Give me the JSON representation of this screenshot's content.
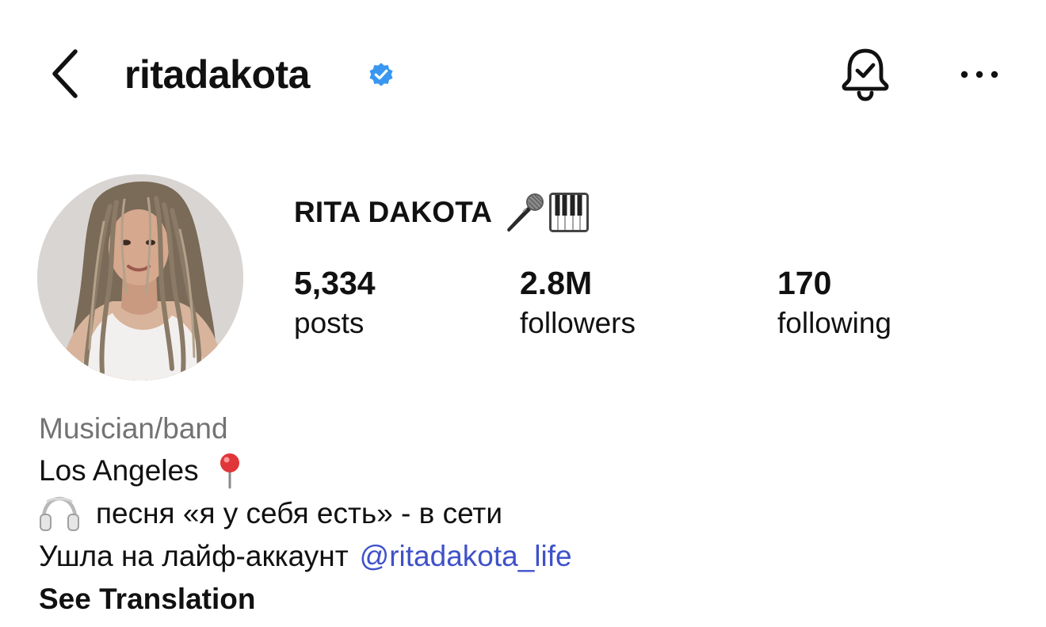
{
  "header": {
    "username": "ritadakota",
    "verified": true,
    "icons": {
      "back": "chevron-left-icon",
      "verified": "verified-badge-icon",
      "notifications": "bell-check-icon",
      "more": "ellipsis-icon"
    }
  },
  "profile": {
    "display_name": "RITA DAKOTA",
    "name_emojis": [
      "microphone-icon",
      "piano-keys-icon"
    ],
    "stats": {
      "posts": {
        "value": "5,334",
        "label": "posts"
      },
      "followers": {
        "value": "2.8M",
        "label": "followers"
      },
      "following": {
        "value": "170",
        "label": "following"
      }
    }
  },
  "bio": {
    "category": "Musician/band",
    "location": "Los Angeles",
    "location_icon": "pushpin-icon",
    "song_icon": "headphones-icon",
    "song_line": "песня «я у себя есть» - в сети",
    "moved_text": "Ушла на лайф-аккаунт",
    "mention": "@ritadakota_life",
    "translate_label": "See Translation"
  },
  "colors": {
    "text": "#111111",
    "muted": "#737373",
    "link": "#3f51c8",
    "verified": "#3897f0"
  }
}
